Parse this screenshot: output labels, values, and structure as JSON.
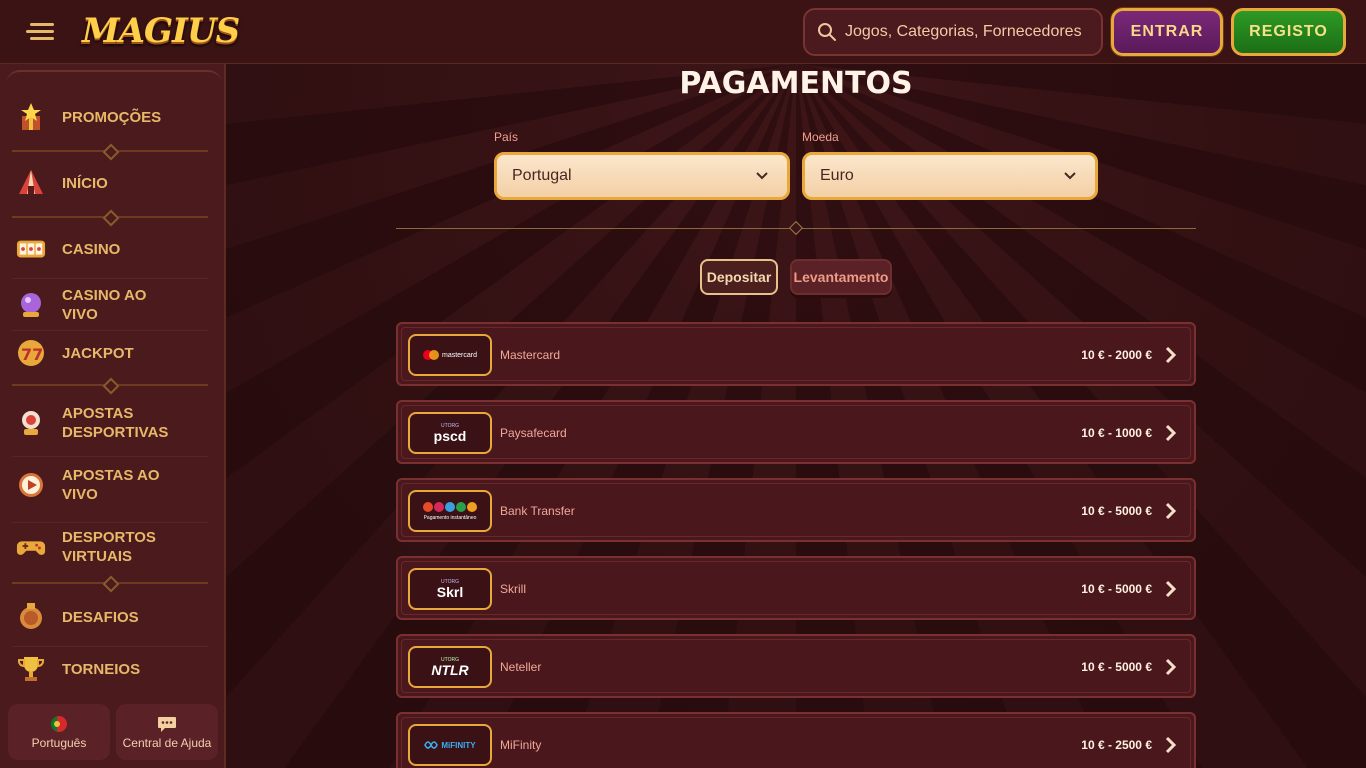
{
  "header": {
    "logo_text": "MAGIUS",
    "search_placeholder": "Jogos, Categorias, Fornecedores",
    "login_label": "ENTRAR",
    "register_label": "REGISTO"
  },
  "sidebar": {
    "items": [
      {
        "label": "PROMOÇÕES",
        "icon": "star-gift-icon"
      },
      {
        "label": "INÍCIO",
        "icon": "circus-tent-icon"
      },
      {
        "label": "CASINO",
        "icon": "slot-reels-icon"
      },
      {
        "label": "CASINO AO VIVO",
        "icon": "crystal-ball-icon"
      },
      {
        "label": "JACKPOT",
        "icon": "sevens-icon"
      },
      {
        "label": "APOSTAS DESPORTIVAS",
        "icon": "sports-globe-icon"
      },
      {
        "label": "APOSTAS AO VIVO",
        "icon": "live-play-icon"
      },
      {
        "label": "DESPORTOS VIRTUAIS",
        "icon": "gamepad-icon"
      },
      {
        "label": "DESAFIOS",
        "icon": "medal-icon"
      },
      {
        "label": "TORNEIOS",
        "icon": "trophy-icon"
      }
    ],
    "language_label": "Português",
    "help_label": "Central de Ajuda"
  },
  "main": {
    "title": "PAGAMENTOS",
    "country_label": "País",
    "country_value": "Portugal",
    "currency_label": "Moeda",
    "currency_value": "Euro",
    "tab_deposit": "Depositar",
    "tab_withdraw": "Levantamento"
  },
  "payments": [
    {
      "name": "Mastercard",
      "range": "10 € - 2000 €",
      "logo": "mastercard"
    },
    {
      "name": "Paysafecard",
      "range": "10 € - 1000 €",
      "logo": "pscd"
    },
    {
      "name": "Bank Transfer",
      "range": "10 € - 5000 €",
      "logo": "Pagamento instantâneo"
    },
    {
      "name": "Skrill",
      "range": "10 € - 5000 €",
      "logo": "Skrl"
    },
    {
      "name": "Neteller",
      "range": "10 € - 5000 €",
      "logo": "NTLR"
    },
    {
      "name": "MiFinity",
      "range": "10 € - 2500 €",
      "logo": "MiFINITY"
    }
  ],
  "logo_badges": {
    "utorg": "UTORG"
  },
  "colors": {
    "accent_gold": "#e8a83a",
    "register_green": "#2e9a24",
    "login_purple": "#7b2878",
    "background": "#3a1416"
  }
}
